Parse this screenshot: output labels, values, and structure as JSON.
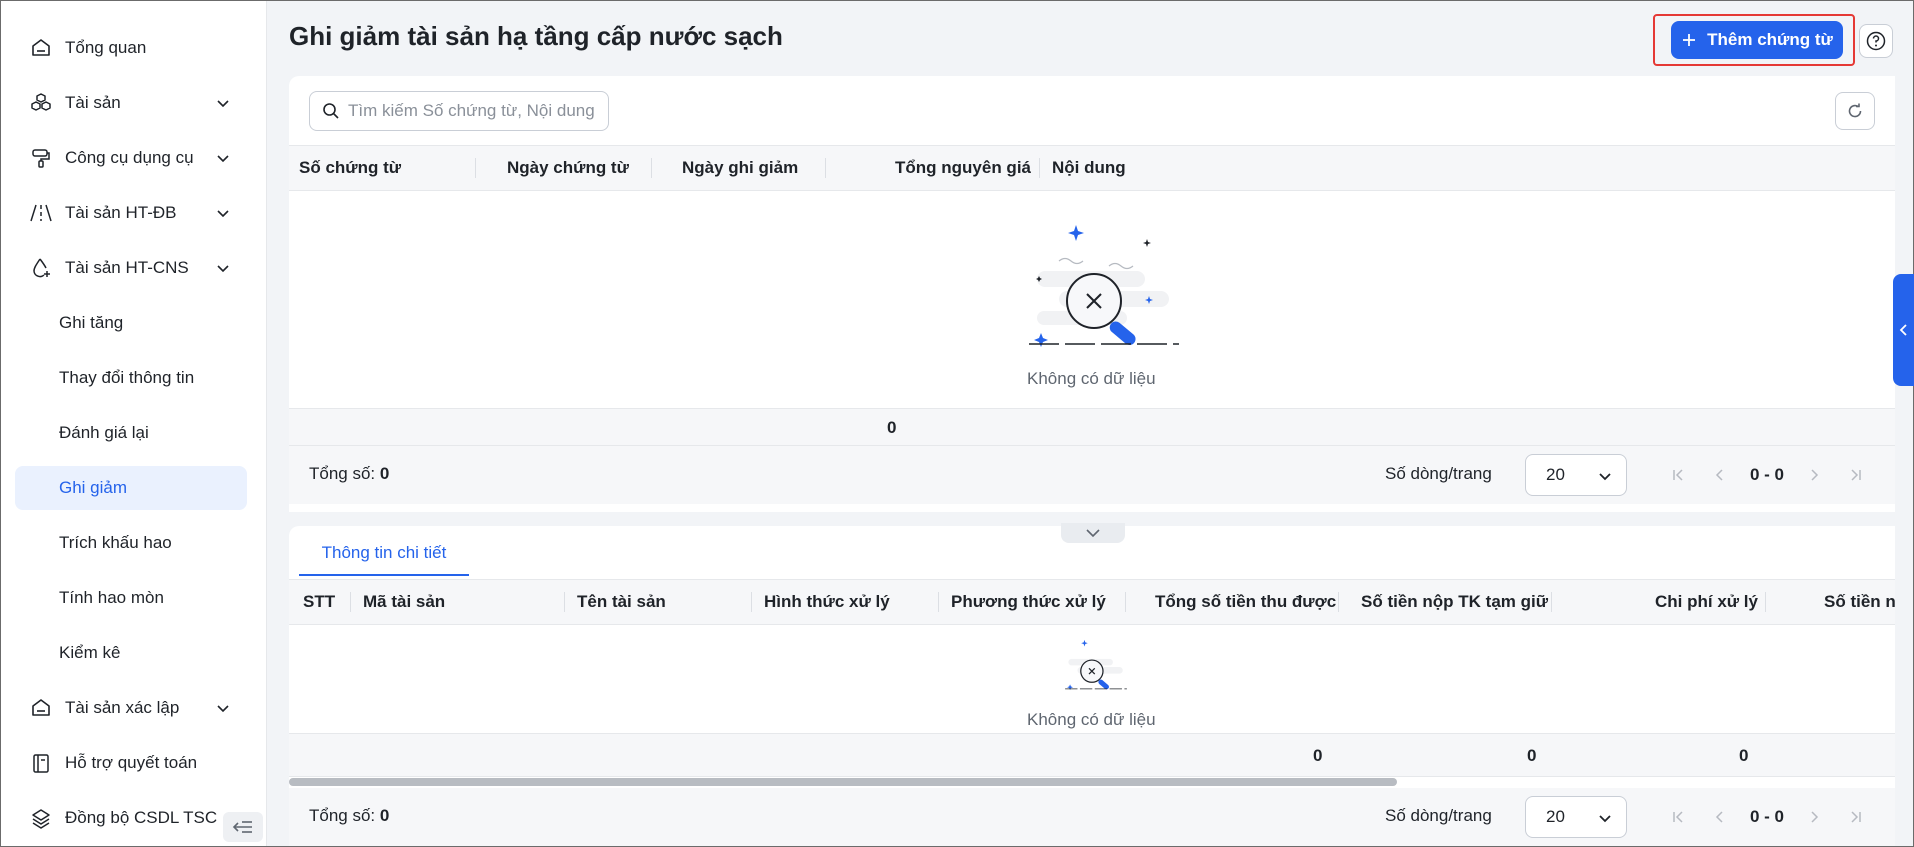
{
  "sidebar": {
    "items": [
      {
        "label": "Tổng quan",
        "icon": "home-icon"
      },
      {
        "label": "Tài sản",
        "icon": "cubes-icon"
      },
      {
        "label": "Công cụ dụng cụ",
        "icon": "paint-roller-icon"
      },
      {
        "label": "Tài sản HT-ĐB",
        "icon": "road-icon"
      },
      {
        "label": "Tài sản HT-CNS",
        "icon": "water-drop-icon"
      }
    ],
    "sub_items": [
      {
        "label": "Ghi tăng"
      },
      {
        "label": "Thay đổi thông tin"
      },
      {
        "label": "Đánh giá lại"
      },
      {
        "label": "Ghi giảm",
        "active": true
      },
      {
        "label": "Trích khấu hao"
      },
      {
        "label": "Tính hao mòn"
      },
      {
        "label": "Kiểm kê"
      }
    ],
    "bottom_items": [
      {
        "label": "Tài sản xác lập",
        "icon": "home-icon"
      },
      {
        "label": "Hỗ trợ quyết toán",
        "icon": "book-icon"
      },
      {
        "label": "Đồng bộ CSDL TSC",
        "icon": "layers-icon"
      }
    ]
  },
  "header": {
    "title": "Ghi giảm tài sản hạ tầng cấp nước sạch",
    "add_button": "Thêm chứng từ"
  },
  "upper": {
    "search_placeholder": "Tìm kiếm Số chứng từ, Nội dung",
    "columns": [
      "Số chứng từ",
      "Ngày chứng từ",
      "Ngày ghi giảm",
      "Tổng nguyên giá",
      "Nội dung"
    ],
    "empty_text": "Không có dữ liệu",
    "sum_total": "0",
    "footer": {
      "total_label": "Tổng số:",
      "total_value": "0",
      "rows_label": "Số dòng/trang",
      "rows_value": "20",
      "range": "0 - 0"
    }
  },
  "lower": {
    "tab": "Thông tin chi tiết",
    "columns": [
      "STT",
      "Mã tài sản",
      "Tên tài sản",
      "Hình thức xử lý",
      "Phương thức xử lý",
      "Tổng số tiền thu được",
      "Số tiền nộp TK tạm giữ",
      "Chi phí xử lý",
      "Số tiền nộ"
    ],
    "empty_text": "Không có dữ liệu",
    "sums": [
      "0",
      "0",
      "0"
    ],
    "footer": {
      "total_label": "Tổng số:",
      "total_value": "0",
      "rows_label": "Số dòng/trang",
      "rows_value": "20",
      "range": "0 - 0"
    }
  },
  "colors": {
    "accent": "#2563eb",
    "highlight_border": "#e53935",
    "active_bg": "#eaf1fe"
  }
}
